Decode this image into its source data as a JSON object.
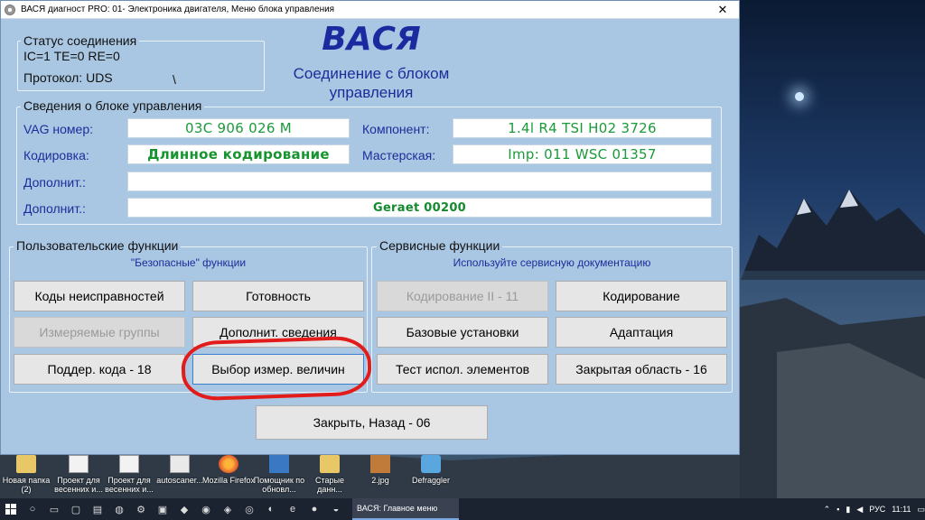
{
  "window": {
    "title": "ВАСЯ диагност PRO: 01- Электроника двигателя,  Меню блока управления",
    "close_glyph": "✕"
  },
  "connection": {
    "title": "Статус соединения",
    "counters": "IC=1  TE=0   RE=0",
    "protocol": "Протокол: UDS",
    "spinner": "\\"
  },
  "header": {
    "logo": "ВАСЯ",
    "subtitle_line1": "Соединение с блоком",
    "subtitle_line2": "управления"
  },
  "ecu": {
    "title": "Сведения о блоке управления",
    "vag_label": "VAG номер:",
    "vag_value": "03C 906 026 M",
    "component_label": "Компонент:",
    "component_value": "1.4l R4 TSI    H02 3726",
    "coding_label": "Кодировка:",
    "coding_value": "Длинное кодирование",
    "workshop_label": "Мастерская:",
    "workshop_value": "Imp: 011     WSC 01357",
    "extra1_label": "Дополнит.:",
    "extra1_value": "",
    "extra2_label": "Дополнит.:",
    "extra2_value": "Geraet 00200"
  },
  "user_functions": {
    "title": "Пользовательские функции",
    "caption": "\"Безопасные\" функции",
    "buttons": [
      "Коды неисправностей",
      "Готовность",
      "Измеряемые группы",
      "Дополнит. сведения",
      "Поддер. кода - 18",
      "Выбор измер. величин"
    ]
  },
  "service_functions": {
    "title": "Сервисные функции",
    "caption": "Используйте сервисную документацию",
    "buttons": [
      "Кодирование II - 11",
      "Кодирование",
      "Базовые установки",
      "Адаптация",
      "Тест испол. элементов",
      "Закрытая область - 16"
    ]
  },
  "close_button": "Закрыть, Назад - 06",
  "desktop_icons": [
    {
      "label": "Новая папка (2)"
    },
    {
      "label": "Проект для весенних и..."
    },
    {
      "label": "Проект для весенних и..."
    },
    {
      "label": "autoscaner..."
    },
    {
      "label": "Mozilla Firefox"
    },
    {
      "label": "Помощник по обновл..."
    },
    {
      "label": "Старые данн..."
    },
    {
      "label": "2.jpg"
    },
    {
      "label": "Defraggler"
    }
  ],
  "taskbar": {
    "task_label": "ВАСЯ:  Главное меню",
    "language": "РУС",
    "time": "11:11"
  },
  "colors": {
    "window_bg": "#a9c7e2",
    "accent_blue": "#1c2aa0",
    "value_green": "#1a9a3a",
    "highlight_red": "#e21b1b"
  }
}
